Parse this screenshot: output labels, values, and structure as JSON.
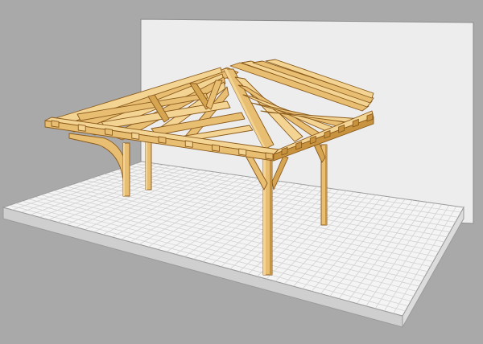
{
  "scene": {
    "background": "#a9a9a9",
    "colors": {
      "wall": "#ededed",
      "wall_edge": "#8c8c8c",
      "patio_top": "#f4f4f4",
      "patio_side": "#dcdcdc",
      "patio_front": "#cfcfcf",
      "paver_line": "#cfcfcf",
      "timber": "#e8be72",
      "timber_light": "#f3d493",
      "timber_dark": "#c8933f",
      "timber_edge": "#8a5a1c"
    }
  }
}
